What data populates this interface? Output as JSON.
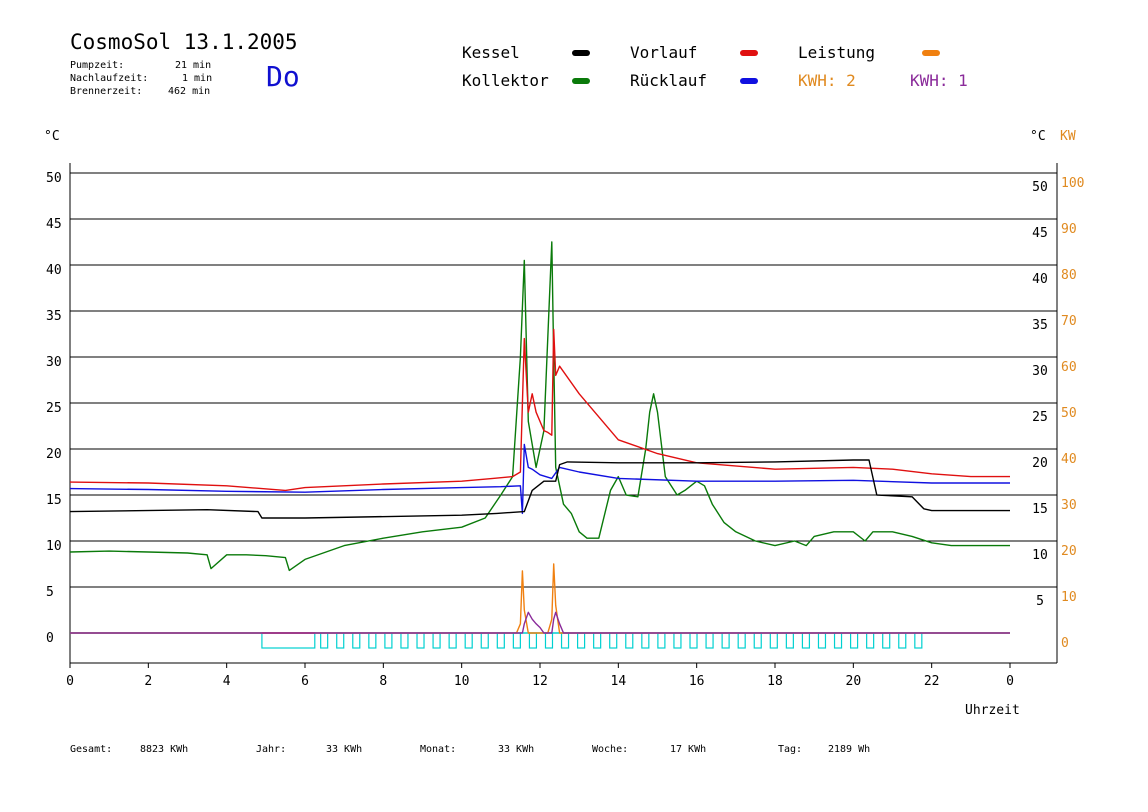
{
  "header": {
    "title": "CosmoSol 13.1.2005",
    "info": [
      {
        "label": "Pumpzeit:",
        "value": "21 min"
      },
      {
        "label": "Nachlaufzeit:",
        "value": "1 min"
      },
      {
        "label": "Brennerzeit:",
        "value": "462 min"
      }
    ],
    "day": "Do"
  },
  "legend": [
    {
      "label": "Kessel",
      "color": "#000000"
    },
    {
      "label": "Kollektor",
      "color": "#0a7a0a"
    },
    {
      "label": "Vorlauf",
      "color": "#e01010"
    },
    {
      "label": "Rücklauf",
      "color": "#1010e0"
    },
    {
      "label": "Leistung",
      "color": "#f08010"
    },
    {
      "label": "KWH: 2",
      "color": "#f08010",
      "text_color": "#e08a20"
    },
    {
      "label": "KWH: 1",
      "color": "#8a2a9a",
      "text_color": "#8a2a9a"
    }
  ],
  "colors": {
    "kessel": "#000000",
    "kollektor": "#0a7a0a",
    "vorlauf": "#e01010",
    "ruecklauf": "#1010e0",
    "leistung": "#f08010",
    "kwh1": "#8a2a9a",
    "pump": "#00d0d0",
    "burner": "#c060a0",
    "right_axis2": "#e08a20"
  },
  "footer": [
    {
      "label": "Gesamt:",
      "value": "8823 KWh"
    },
    {
      "label": "Jahr:",
      "value": "33 KWh"
    },
    {
      "label": "Monat:",
      "value": "33 KWh"
    },
    {
      "label": "Woche:",
      "value": "17 KWh"
    },
    {
      "label": "Tag:",
      "value": "2189 Wh"
    }
  ],
  "chart_data": {
    "type": "line",
    "xlabel": "Uhrzeit",
    "ylabel_left": "°C",
    "ylabel_right": "°C",
    "ylabel_right2": "KW",
    "xlim": [
      0,
      24
    ],
    "ylim": [
      0,
      50
    ],
    "ylim_right2": [
      0,
      100
    ],
    "x_ticks": [
      0,
      2,
      4,
      6,
      8,
      10,
      12,
      14,
      16,
      18,
      20,
      22,
      24
    ],
    "x_tick_labels": [
      "0",
      "2",
      "4",
      "6",
      "8",
      "10",
      "12",
      "14",
      "16",
      "18",
      "20",
      "22",
      "0"
    ],
    "y_ticks": [
      0,
      5,
      10,
      15,
      20,
      25,
      30,
      35,
      40,
      45,
      50
    ],
    "y_ticks_right2": [
      0,
      10,
      20,
      30,
      40,
      50,
      60,
      70,
      80,
      90,
      100
    ],
    "grid": true,
    "series": [
      {
        "name": "Kessel",
        "x": [
          0,
          3.5,
          4.8,
          4.9,
          6,
          10,
          10.9,
          11.6,
          11.8,
          12.1,
          12.4,
          12.5,
          12.7,
          14,
          16,
          18,
          20,
          20.4,
          20.6,
          21.5,
          21.8,
          22,
          24
        ],
        "y": [
          13.2,
          13.4,
          13.2,
          12.5,
          12.5,
          12.8,
          13,
          13.2,
          15.5,
          16.5,
          16.5,
          18.3,
          18.6,
          18.5,
          18.5,
          18.6,
          18.8,
          18.8,
          15,
          14.8,
          13.5,
          13.3,
          13.3
        ]
      },
      {
        "name": "Kollektor",
        "x": [
          0,
          1,
          2,
          3,
          3.5,
          3.6,
          4,
          4.5,
          5,
          5.5,
          5.6,
          6,
          7,
          8,
          9,
          10,
          10.6,
          11,
          11.3,
          11.5,
          11.6,
          11.7,
          11.9,
          12.1,
          12.3,
          12.35,
          12.4,
          12.6,
          12.8,
          13,
          13.2,
          13.5,
          13.8,
          14,
          14.2,
          14.5,
          14.7,
          14.8,
          14.9,
          15,
          15.2,
          15.5,
          15.7,
          16,
          16.2,
          16.4,
          16.7,
          17,
          17.5,
          18,
          18.5,
          18.8,
          19,
          19.5,
          20,
          20.3,
          20.5,
          21,
          21.5,
          22,
          22.5,
          23,
          24
        ],
        "y": [
          8.8,
          8.9,
          8.8,
          8.7,
          8.5,
          7,
          8.5,
          8.5,
          8.4,
          8.2,
          6.8,
          8,
          9.5,
          10.3,
          11,
          11.5,
          12.5,
          15,
          17,
          30,
          40.5,
          23,
          18,
          22,
          42.5,
          30,
          18,
          14,
          13,
          11,
          10.3,
          10.3,
          15.5,
          17,
          15,
          14.8,
          20,
          24,
          26,
          24,
          17,
          15,
          15.5,
          16.5,
          16,
          14,
          12,
          11,
          10,
          9.5,
          10,
          9.5,
          10.5,
          11,
          11,
          10,
          11,
          11,
          10.5,
          9.8,
          9.5,
          9.5,
          9.5
        ]
      },
      {
        "name": "Vorlauf",
        "x": [
          0,
          2,
          4,
          5.5,
          6,
          8,
          10,
          10.8,
          11.3,
          11.5,
          11.6,
          11.7,
          11.8,
          11.9,
          12.1,
          12.2,
          12.3,
          12.35,
          12.4,
          12.5,
          13,
          14,
          15,
          16,
          18,
          20,
          21,
          22,
          23,
          24
        ],
        "y": [
          16.4,
          16.3,
          16,
          15.5,
          15.8,
          16.2,
          16.5,
          16.8,
          17,
          17.5,
          32,
          24,
          26,
          24,
          22,
          21.8,
          21.5,
          33,
          28,
          29,
          26,
          21,
          19.5,
          18.5,
          17.8,
          18,
          17.8,
          17.3,
          17,
          17
        ]
      },
      {
        "name": "Rücklauf",
        "x": [
          0,
          2,
          4,
          6,
          8,
          10,
          11,
          11.5,
          11.55,
          11.6,
          11.7,
          11.8,
          12,
          12.3,
          12.5,
          13,
          14,
          16,
          18,
          20,
          22,
          24
        ],
        "y": [
          15.7,
          15.6,
          15.4,
          15.3,
          15.6,
          15.8,
          15.9,
          16,
          13,
          20.5,
          18,
          17.8,
          17.2,
          16.8,
          18,
          17.5,
          16.8,
          16.5,
          16.5,
          16.6,
          16.3,
          16.3
        ]
      },
      {
        "name": "Leistung",
        "axis": "right2",
        "x": [
          0,
          11.4,
          11.5,
          11.55,
          11.6,
          11.7,
          12.2,
          12.3,
          12.35,
          12.4,
          12.5,
          24
        ],
        "y": [
          0,
          0,
          2,
          13.5,
          5,
          0,
          0,
          3,
          15,
          6,
          0,
          0
        ]
      },
      {
        "name": "KWH: 1",
        "axis": "right2",
        "x": [
          0,
          11.55,
          11.6,
          11.7,
          11.8,
          11.9,
          12.0,
          12.1,
          12.3,
          12.35,
          12.4,
          12.5,
          12.6,
          24
        ],
        "y": [
          0,
          0,
          2,
          4.5,
          3,
          2,
          1.2,
          0,
          0,
          3,
          4.5,
          2,
          0,
          0
        ]
      }
    ],
    "pump_intervals": [
      [
        4.9,
        6.25
      ]
    ],
    "pump_pulses_start": 6.4,
    "pump_pulses_end": 21.9
  }
}
